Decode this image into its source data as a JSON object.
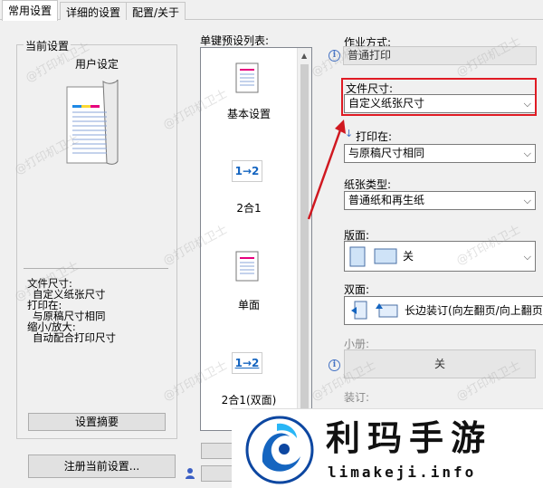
{
  "tabs": [
    {
      "label": "常用设置"
    },
    {
      "label": "详细的设置"
    },
    {
      "label": "配置/关于"
    }
  ],
  "current_settings": {
    "title": "当前设置",
    "preset_name": "用户设定",
    "summary": [
      {
        "label": "文件尺寸:",
        "value": "自定义纸张尺寸"
      },
      {
        "label": "打印在:",
        "value": "与原稿尺寸相同"
      },
      {
        "label": "缩小/放大:",
        "value": "自动配合打印尺寸"
      }
    ],
    "summary_button": "设置摘要",
    "register_button": "注册当前设置..."
  },
  "presets": {
    "title": "单键预设列表:",
    "items": [
      {
        "label": "基本设置",
        "icon": "document-icon"
      },
      {
        "label": "2合1",
        "icon": "two-in-one-icon",
        "glyph": "1→2"
      },
      {
        "label": "单面",
        "icon": "document-icon"
      },
      {
        "label": "2合1(双面)",
        "icon": "two-in-one-duplex-icon",
        "glyph": "1→2"
      }
    ]
  },
  "settings": {
    "job_mode": {
      "label": "作业方式:",
      "value": "普通打印"
    },
    "paper_size": {
      "label": "文件尺寸:",
      "value": "自定义纸张尺寸"
    },
    "print_on": {
      "label": "打印在:",
      "value": "与原稿尺寸相同"
    },
    "paper_type": {
      "label": "纸张类型:",
      "value": "普通纸和再生纸"
    },
    "layout": {
      "label": "版面:",
      "value": "关"
    },
    "duplex": {
      "label": "双面:",
      "value": "长边装订(向左翻页/向上翻页)"
    },
    "booklet": {
      "label": "小册:",
      "value": "关"
    },
    "binding": {
      "label": "装订:"
    }
  },
  "watermark_text": "@打印机卫士",
  "overlay": {
    "title": "利玛手游",
    "subtitle": "limakeji.info"
  },
  "colors": {
    "highlight_border": "#e01b24",
    "arrow": "#d01820",
    "overlay_bg": "#ffffff",
    "logo_blue": "#1565c0"
  }
}
